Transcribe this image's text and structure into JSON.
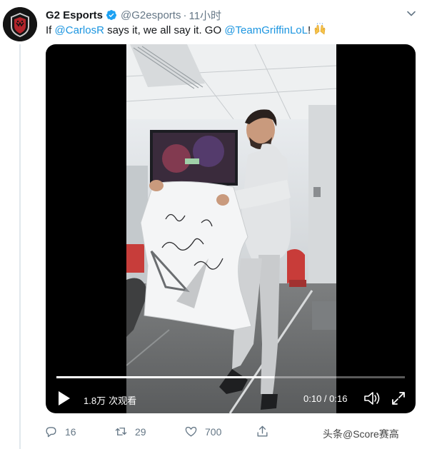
{
  "tweet": {
    "author_name": "G2 Esports",
    "handle": "@G2esports",
    "separator": "·",
    "time": "11小时",
    "text_parts": {
      "t1": "If ",
      "m1": "@CarlosR",
      "t2": " says it, we all say it. GO ",
      "m2": "@TeamGriffinLoL",
      "t3": "! "
    },
    "emoji": "raising-hands"
  },
  "video": {
    "views_count": "1.8万",
    "views_label": "次观看",
    "current_time": "0:10",
    "duration": "0:16",
    "timecode": "0:10 / 0:16",
    "progress": 0.625
  },
  "actions": {
    "replies": "16",
    "retweets": "29",
    "likes": "700"
  },
  "watermark": "头条@Score赛高",
  "colors": {
    "link": "#1b95e0",
    "secondary": "#657786",
    "verified": "#1da1f2"
  },
  "icons": [
    "g2-logo-avatar",
    "verified-icon",
    "chevron-down-icon",
    "play-icon",
    "volume-icon",
    "fullscreen-icon",
    "reply-icon",
    "retweet-icon",
    "like-icon",
    "share-icon"
  ]
}
